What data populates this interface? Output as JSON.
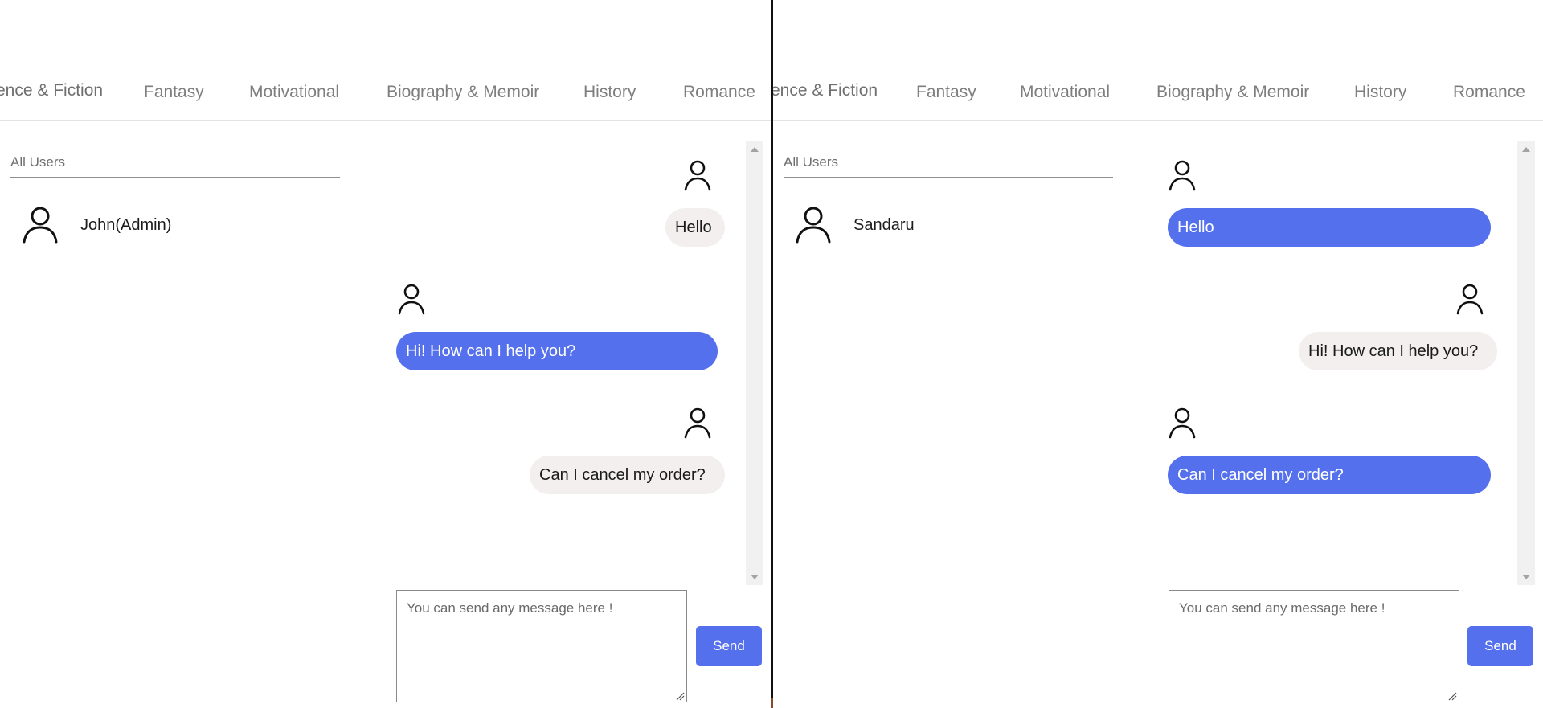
{
  "categories": [
    "ence & Fiction",
    "Fantasy",
    "Motivational",
    "Biography & Memoir",
    "History",
    "Romance"
  ],
  "left_window": {
    "search_placeholder": "All Users",
    "user_name": "John(Admin)",
    "messages": [
      {
        "text": "Hello",
        "style": "grey",
        "side": "right"
      },
      {
        "text": "Hi! How can I help you?",
        "style": "blue",
        "side": "left"
      },
      {
        "text": "Can I cancel my order?",
        "style": "grey",
        "side": "right"
      }
    ],
    "input_placeholder": "You can send any message here !",
    "send_label": "Send"
  },
  "right_window": {
    "search_placeholder": "All Users",
    "user_name": "Sandaru",
    "messages": [
      {
        "text": "Hello",
        "style": "blue",
        "side": "left"
      },
      {
        "text": "Hi! How can I help you?",
        "style": "grey",
        "side": "right"
      },
      {
        "text": "Can I cancel my order?",
        "style": "blue",
        "side": "left"
      }
    ],
    "input_placeholder": "You can send any message here !",
    "send_label": "Send"
  },
  "colors": {
    "accent": "#5570ec",
    "bubble_grey": "#f3efef",
    "nav_text": "#7e7e7e",
    "divider": "#111111"
  },
  "icons": [
    "user-icon",
    "scroll-up-icon",
    "scroll-down-icon",
    "resize-grip-icon"
  ]
}
